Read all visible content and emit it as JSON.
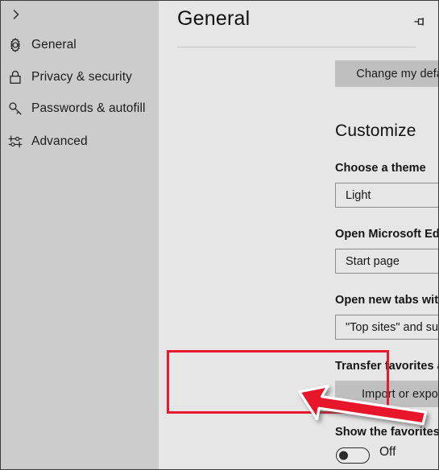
{
  "window": {
    "accent_red": "#e8192c",
    "sidebar_bg": "#cccccc",
    "panel_bg": "#e6e6e6",
    "button_bg": "#bfbfbf"
  },
  "sidebar": {
    "collapse_icon": "chevron-right-icon",
    "items": [
      {
        "label": "General",
        "icon": "gear-icon"
      },
      {
        "label": "Privacy & security",
        "icon": "lock-icon"
      },
      {
        "label": "Passwords & autofill",
        "icon": "key-icon"
      },
      {
        "label": "Advanced",
        "icon": "sliders-icon"
      }
    ]
  },
  "panel": {
    "title": "General",
    "pin_icon": "pin-icon",
    "change_default_label": "Change my default",
    "customize_title": "Customize",
    "fields": [
      {
        "label": "Choose a theme",
        "value": "Light",
        "chevron": "chevron-down-icon"
      },
      {
        "label": "Open Microsoft Edge with",
        "value": "Start page",
        "chevron": "chevron-down-icon"
      },
      {
        "label": "Open new tabs with",
        "value": "\"Top sites\" and suggested content",
        "chevron": "chevron-down-icon"
      }
    ],
    "transfer_label": "Transfer favorites and other info",
    "import_export_label": "Import or export",
    "favorites_bar_label": "Show the favorites bar",
    "favorites_bar_state": "Off"
  },
  "annotations": {
    "highlight_box": {
      "color": "#e8192c",
      "target": "transfer-favorites-section"
    },
    "arrow": {
      "color": "#e8192c",
      "points_to": "import-or-export-button"
    }
  }
}
